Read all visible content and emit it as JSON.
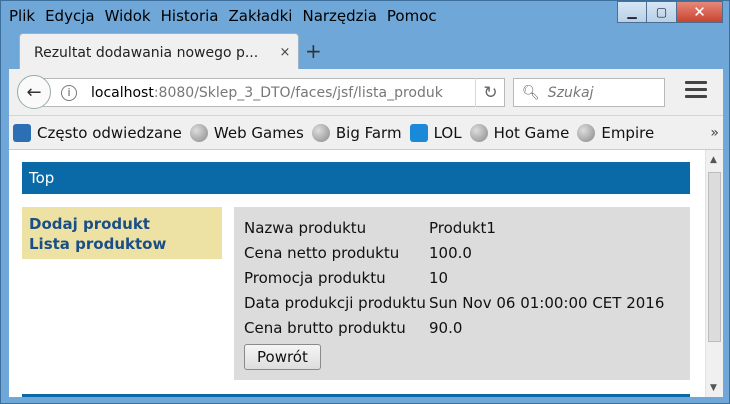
{
  "window": {
    "menu": [
      "Plik",
      "Edycja",
      "Widok",
      "Historia",
      "Zakładki",
      "Narzędzia",
      "Pomoc"
    ]
  },
  "tab": {
    "title": "Rezultat dodawania nowego p...",
    "close": "×",
    "new": "+"
  },
  "nav": {
    "url_host": "localhost",
    "url_rest": ":8080/Sklep_3_DTO/faces/jsf/lista_produk",
    "search_placeholder": "Szukaj"
  },
  "bookmarks": [
    "Często odwiedzane",
    "Web Games",
    "Big Farm",
    "LOL",
    "Hot Game",
    "Empire"
  ],
  "page": {
    "top_label": "Top",
    "sidebar_links": [
      "Dodaj produkt",
      "Lista produktow"
    ],
    "details": [
      {
        "label": "Nazwa produktu",
        "value": "Produkt1"
      },
      {
        "label": "Cena netto produktu",
        "value": "100.0"
      },
      {
        "label": "Promocja produktu",
        "value": "10"
      },
      {
        "label": "Data produkcji produktu",
        "value": "Sun Nov 06 01:00:00 CET 2016"
      },
      {
        "label": "Cena brutto produktu",
        "value": "90.0"
      }
    ],
    "back_button": "Powrót"
  },
  "colors": {
    "top_bar": "#0a6aa8",
    "sidebar_bg": "#ede2a3",
    "panel_bg": "#dcdcdc",
    "link": "#1a4e86"
  }
}
